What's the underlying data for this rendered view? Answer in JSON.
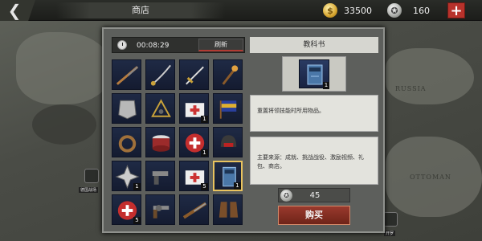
{
  "topbar": {
    "back_label": "❮",
    "title": "商店",
    "gold": {
      "icon": "gold-coin-icon",
      "value": "33500"
    },
    "silver": {
      "icon": "silver-medal-icon",
      "value": "160"
    },
    "plus_label": "+"
  },
  "map": {
    "labels": [
      "RUSSIA",
      "OTTOMAN"
    ],
    "buttons": [
      {
        "icon": "fortress-icon",
        "label": "德国战场"
      },
      {
        "icon": "helmet-icon",
        "label": "开罗"
      }
    ]
  },
  "shop": {
    "timer": "00:08:29",
    "refresh_label": "刷新",
    "items": [
      {
        "icon": "rifle-icon",
        "count": ""
      },
      {
        "icon": "saber-icon",
        "count": ""
      },
      {
        "icon": "sword-icon",
        "count": ""
      },
      {
        "icon": "torch-icon",
        "count": ""
      },
      {
        "icon": "breastplate-icon",
        "count": ""
      },
      {
        "icon": "sextant-icon",
        "count": ""
      },
      {
        "icon": "medkit-icon",
        "count": "1"
      },
      {
        "icon": "flag-icon",
        "count": ""
      },
      {
        "icon": "rope-icon",
        "count": ""
      },
      {
        "icon": "drum-icon",
        "count": ""
      },
      {
        "icon": "medic-badge-icon",
        "count": "1"
      },
      {
        "icon": "helmet-icon",
        "count": ""
      },
      {
        "icon": "spiked-shield-icon",
        "count": "1"
      },
      {
        "icon": "pistol-icon",
        "count": ""
      },
      {
        "icon": "medkit-icon",
        "count": "5"
      },
      {
        "icon": "textbook-icon",
        "count": "1",
        "selected": true
      },
      {
        "icon": "medic-badge-icon",
        "count": "5"
      },
      {
        "icon": "revolver-icon",
        "count": ""
      },
      {
        "icon": "musket-icon",
        "count": ""
      },
      {
        "icon": "boots-icon",
        "count": ""
      }
    ]
  },
  "detail": {
    "title": "教科书",
    "icon": "textbook-icon",
    "count": "1",
    "description": "重置将领技能时所用物品。",
    "source": "主要来源：成就、挑战战役、激励视频、礼包、商店。",
    "price_icon": "silver-medal-icon",
    "price": "45",
    "buy_label": "购买"
  },
  "colors": {
    "buy_button": "#8a2f24",
    "plus_button": "#b8322b",
    "slot_bg": "#1a2340",
    "selected_border": "#e9c35e"
  }
}
